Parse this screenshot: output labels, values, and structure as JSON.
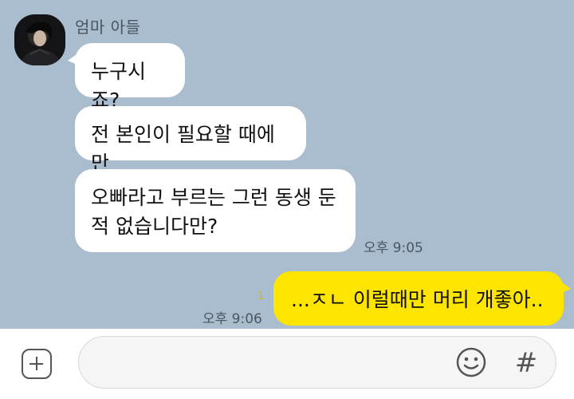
{
  "chat": {
    "sender_name": "엄마 아들",
    "received": [
      {
        "text": "누구시죠?"
      },
      {
        "text": "전 본인이 필요할 때에만"
      },
      {
        "line1": "오빠라고 부르는 그런 동생 둔",
        "line2": "적 없습니다만?"
      }
    ],
    "received_time": "오후 9:05",
    "sent": {
      "text": "...ㅈㄴ 이럴때만 머리 개좋아..",
      "time": "오후 9:06",
      "unread_count": "1"
    }
  },
  "input_bar": {
    "icons": [
      "plus-icon",
      "emoji-icon",
      "hashtag-icon"
    ],
    "hash_symbol": "#"
  },
  "colors": {
    "chat_background": "#a9bdce",
    "received_bubble": "#ffffff",
    "sent_bubble": "#fee500",
    "unread_count": "#e0b800"
  }
}
